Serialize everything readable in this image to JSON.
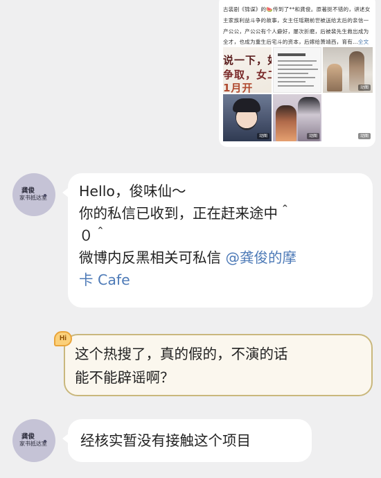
{
  "shared_post": {
    "text_prefix": "古装剧《锦谋》的",
    "text_body": "传到了**和龚俊。原著挺不错的，讲述女主家族利益斗争的故事，女主任瑶期前世被送给太后的亲信一产公公，产公公有个人癖好，屡次折磨，后被裴先生救出成为全才，也成为重生后宅斗的资本，后嫁给萧靖西，育有...",
    "full_text_link": "全文",
    "image1_lines": [
      "说一下，如",
      "争取，女二",
      "1月开"
    ],
    "badge_gif": "动图",
    "badge_gif_2": "动图",
    "badge_gif_3": "动图",
    "badge_gif_4": "动图"
  },
  "sender_avatar": {
    "line1": "龚俊",
    "line2": "家书抵达室"
  },
  "messages": {
    "reply_1": {
      "line1": "Hello，俊味仙～",
      "line2": "你的私信已收到，正在赶来途中＾",
      "line3": "０＾",
      "line4_prefix": "微博内反黑相关可私信",
      "line4_mention": "@龚俊的摩",
      "line5_mention": "卡 Cafe"
    },
    "user_message": {
      "badge": "Hi",
      "line1": "这个热搜了，真的假的，不演的话",
      "line2": "能不能辟谣啊？"
    },
    "reply_2": {
      "text": "经核实暂没有接触这个项目"
    }
  },
  "colors": {
    "background": "#efeff0",
    "bubble": "#ffffff",
    "mention": "#4d7ab7",
    "user_bubble_border": "#c9b77c",
    "avatar": "#c5c3d6"
  }
}
